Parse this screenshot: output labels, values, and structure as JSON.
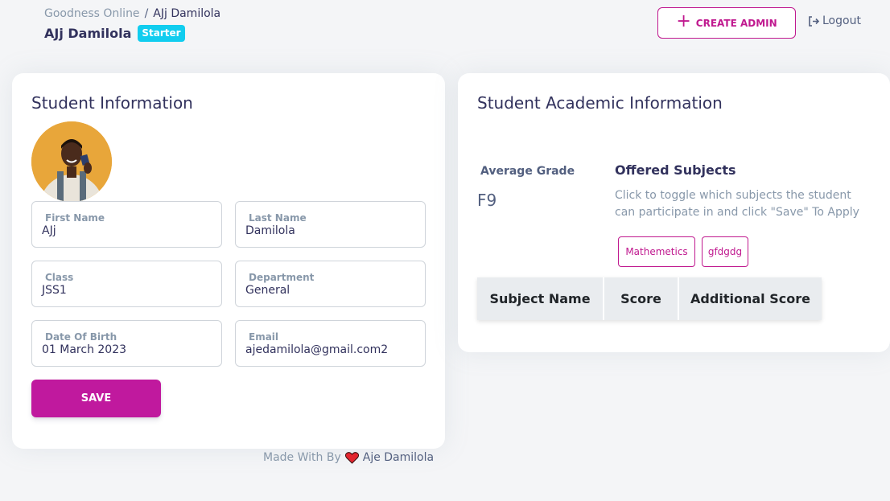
{
  "header": {
    "breadcrumb": {
      "root": "Goodness Online",
      "separator": "/",
      "current": "AJj Damilola"
    },
    "title": "AJj Damilola",
    "plan_badge": "Starter",
    "create_admin_label": "CREATE ADMIN",
    "create_admin_icon": "plus-icon",
    "logout_label": "Logout",
    "logout_icon": "sign-out-icon"
  },
  "student_info": {
    "title": "Student Information",
    "fields": {
      "first_name": {
        "label": "First Name",
        "value": "AJj"
      },
      "last_name": {
        "label": "Last Name",
        "value": "Damilola"
      },
      "class": {
        "label": "Class",
        "value": "JSS1"
      },
      "department": {
        "label": "Department",
        "value": "General"
      },
      "dob": {
        "label": "Date Of Birth",
        "value": "01 March 2023"
      },
      "email": {
        "label": "Email",
        "value": "ajedamilola@gmail.com2"
      }
    },
    "save_label": "SAVE"
  },
  "academic_info": {
    "title": "Student Academic Information",
    "average_grade_label": "Average Grade",
    "average_grade_value": "F9",
    "offered_subjects_title": "Offered Subjects",
    "offered_subjects_help": "Click to toggle which subjects the student can participate in and click \"Save\" To Apply",
    "subjects": [
      "Mathemetics",
      "gfdgdg"
    ],
    "table_headers": [
      "Subject Name",
      "Score",
      "Additional Score"
    ]
  },
  "footer": {
    "prefix": "Made With By",
    "icon": "heart-icon",
    "author": "Aje Damilola"
  },
  "colors": {
    "accent": "#c0198f",
    "badge": "#11cdef",
    "background": "#f4f5f7"
  }
}
